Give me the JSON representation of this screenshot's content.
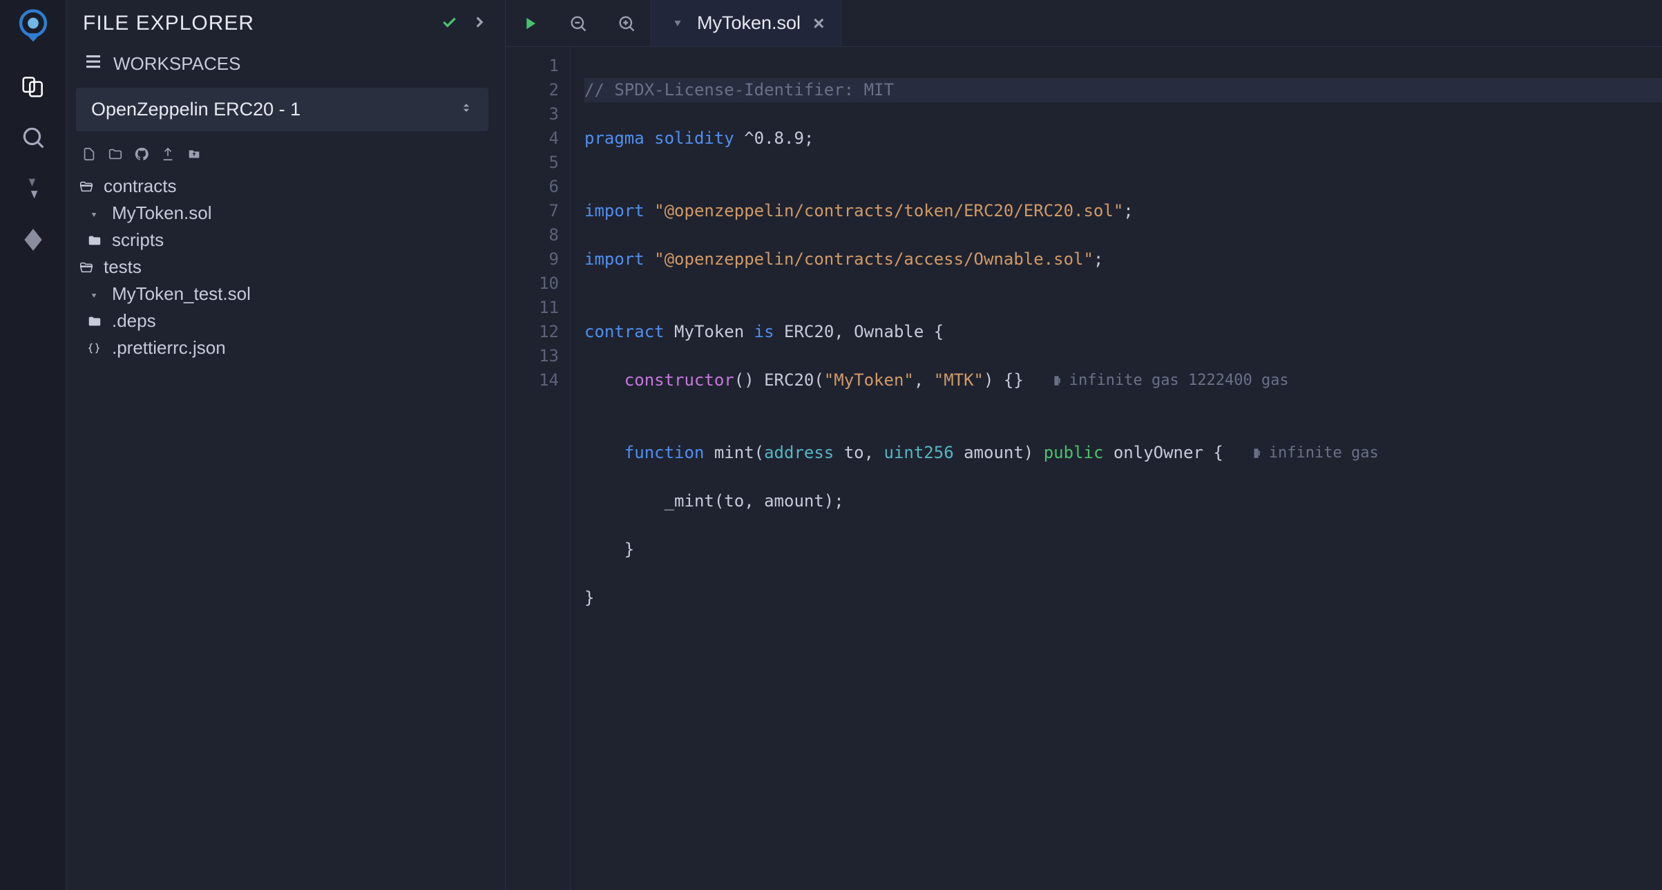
{
  "panel": {
    "title": "FILE EXPLORER",
    "workspaces_label": "WORKSPACES"
  },
  "workspace_selector": {
    "selected": "OpenZeppelin ERC20 - 1"
  },
  "file_tree": {
    "folder_contracts": "contracts",
    "file_mytoken": "MyToken.sol",
    "folder_scripts": "scripts",
    "folder_tests": "tests",
    "file_mytoken_test": "MyToken_test.sol",
    "folder_deps": ".deps",
    "file_prettier": ".prettierrc.json"
  },
  "editor": {
    "tab_name": "MyToken.sol",
    "gutter": [
      "1",
      "2",
      "3",
      "4",
      "5",
      "6",
      "7",
      "8",
      "9",
      "10",
      "11",
      "12",
      "13",
      "14"
    ],
    "code": {
      "l1_comment": "// SPDX-License-Identifier: MIT",
      "l2_pragma": "pragma",
      "l2_solidity": "solidity",
      "l2_version": "^0.8.9;",
      "l4_import": "import",
      "l4_path": "\"@openzeppelin/contracts/token/ERC20/ERC20.sol\"",
      "l5_import": "import",
      "l5_path": "\"@openzeppelin/contracts/access/Ownable.sol\"",
      "l7_contract": "contract",
      "l7_name": "MyToken",
      "l7_is": "is",
      "l7_inherits": "ERC20, Ownable {",
      "l8_constructor": "constructor",
      "l8_rest1": "() ERC20(",
      "l8_str1": "\"MyToken\"",
      "l8_str2": "\"MTK\"",
      "l8_rest2": ") {}",
      "l8_gas": "infinite gas 1222400 gas",
      "l10_function": "function",
      "l10_name": "mint(",
      "l10_addr": "address",
      "l10_to": " to,",
      "l10_uint": "uint256",
      "l10_amt": " amount)",
      "l10_pub": "public",
      "l10_only": " onlyOwner {",
      "l10_gas": "infinite gas",
      "l11_body": "_mint(to, amount);",
      "l12_close": "}",
      "l13_close": "}"
    }
  }
}
